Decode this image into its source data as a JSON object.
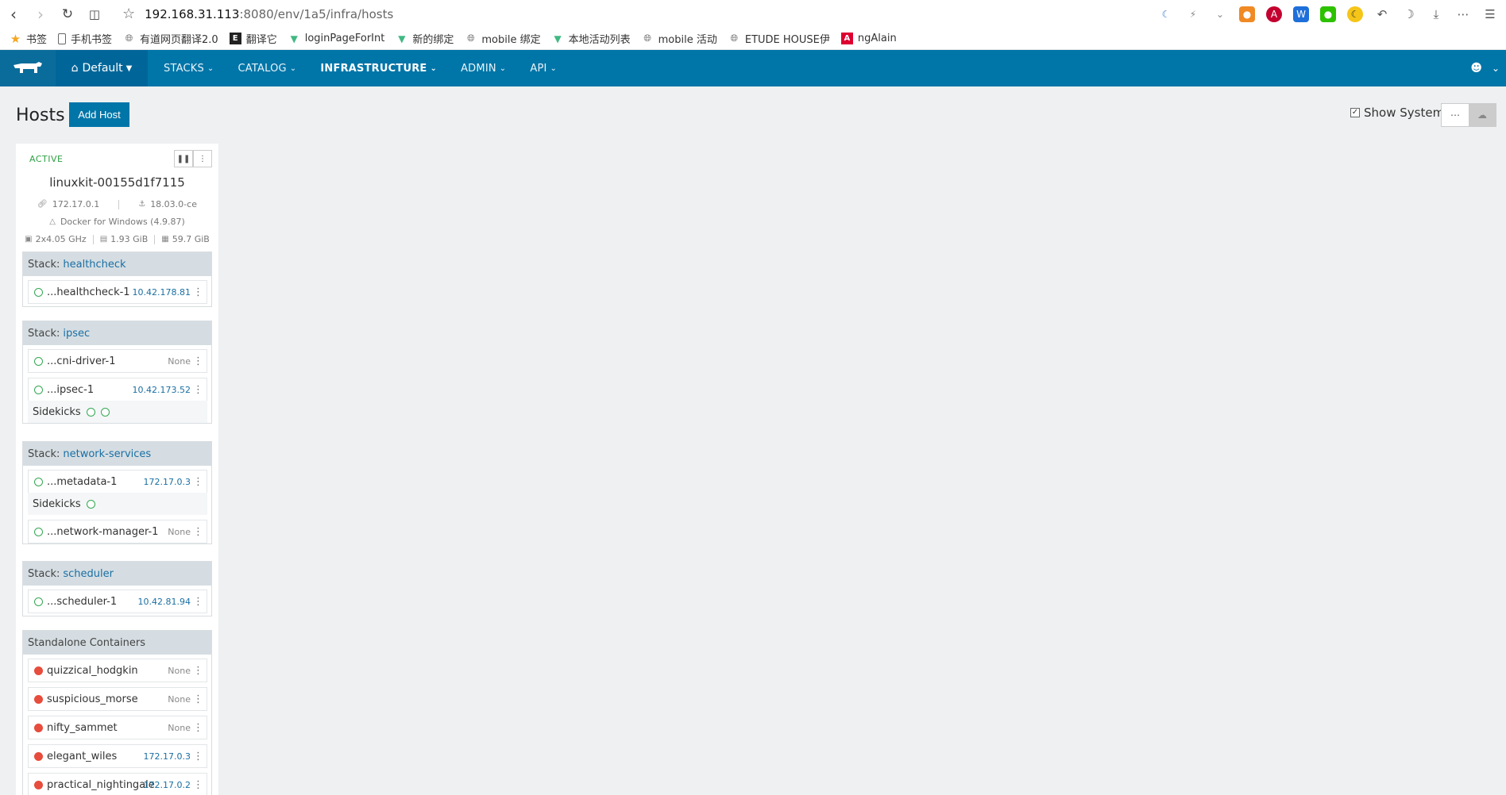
{
  "browser": {
    "url_host": "192.168.31.113",
    "url_path": ":8080/env/1a5/infra/hosts",
    "bookmarks": [
      "书签",
      "手机书签",
      "有道网页翻译2.0",
      "翻译它",
      "loginPageForInt",
      "新的绑定",
      "mobile 绑定",
      "本地活动列表",
      "mobile 活动",
      "ETUDE HOUSE伊",
      "ngAlain"
    ]
  },
  "header": {
    "environment": "Default",
    "menu": [
      "STACKS",
      "CATALOG",
      "INFRASTRUCTURE",
      "ADMIN",
      "API"
    ],
    "active_menu": "INFRASTRUCTURE"
  },
  "page": {
    "title": "Hosts",
    "add_host_label": "Add Host",
    "show_system_label": "Show System",
    "show_system_checked": true
  },
  "host": {
    "state": "ACTIVE",
    "name": "linuxkit-00155d1f7115",
    "ip": "172.17.0.1",
    "docker_version": "18.03.0-ce",
    "os": "Docker for Windows (4.9.87)",
    "cpu": "2x4.05 GHz",
    "memory": "1.93 GiB",
    "storage": "59.7 GiB",
    "stack_prefix": "Stack:",
    "sidekicks_label": "Sidekicks",
    "stacks": [
      {
        "name": "healthcheck",
        "containers": [
          {
            "name": "...healthcheck-1",
            "ip": "10.42.178.81",
            "status": "ok"
          }
        ]
      },
      {
        "name": "ipsec",
        "containers": [
          {
            "name": "...cni-driver-1",
            "ip": "None",
            "status": "ok"
          },
          {
            "name": "...ipsec-1",
            "ip": "10.42.173.52",
            "status": "ok"
          }
        ]
      },
      {
        "name": "network-services",
        "containers": [
          {
            "name": "...metadata-1",
            "ip": "172.17.0.3",
            "status": "ok"
          },
          {
            "name": "...network-manager-1",
            "ip": "None",
            "status": "ok"
          }
        ]
      },
      {
        "name": "scheduler",
        "containers": [
          {
            "name": "...scheduler-1",
            "ip": "10.42.81.94",
            "status": "ok"
          }
        ]
      }
    ],
    "standalone": {
      "title": "Standalone Containers",
      "containers": [
        {
          "name": "quizzical_hodgkin",
          "ip": "None",
          "status": "error"
        },
        {
          "name": "suspicious_morse",
          "ip": "None",
          "status": "error"
        },
        {
          "name": "nifty_sammet",
          "ip": "None",
          "status": "error"
        },
        {
          "name": "elegant_wiles",
          "ip": "172.17.0.3",
          "status": "error"
        },
        {
          "name": "practical_nightingale",
          "ip": "172.17.0.2",
          "status": "error"
        }
      ]
    }
  }
}
